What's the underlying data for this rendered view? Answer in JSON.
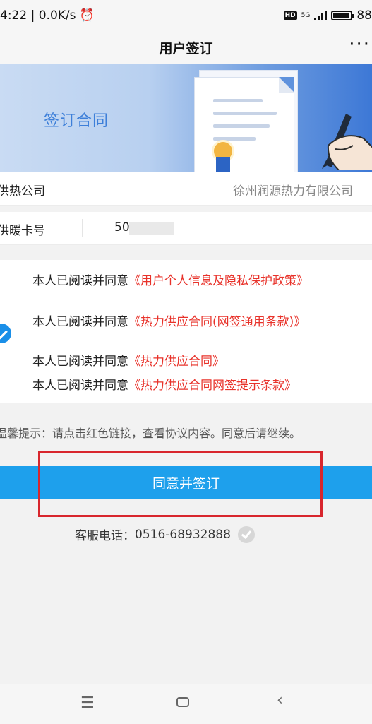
{
  "status_bar": {
    "time": "4:22",
    "separator": "|",
    "speed": "0.0K/s",
    "alarm_icon": "alarm-clock-icon",
    "hd": "HD",
    "network": "5G",
    "battery": "88"
  },
  "nav": {
    "title": "用户签订",
    "more": "···"
  },
  "banner": {
    "title": "签订合同"
  },
  "fields": {
    "company_label": "供热公司",
    "company_value": "徐州润源热力有限公司",
    "card_label": "供暖卡号",
    "card_value": "50"
  },
  "agreements": [
    {
      "prefix": "本人已阅读并同意",
      "link": "《用户个人信息及隐私保护政策》"
    },
    {
      "prefix": "本人已阅读并同意",
      "link": "《热力供应合同(网签通用条款)》"
    },
    {
      "prefix": "本人已阅读并同意",
      "link": "《热力供应合同》"
    },
    {
      "prefix": "本人已阅读并同意",
      "link": "《热力供应合同网签提示条款》"
    }
  ],
  "tip": "温馨提示：请点击红色链接，查看协议内容。同意后请继续。",
  "sign_button": "同意并签订",
  "service": {
    "label": "客服电话：",
    "phone": "0516-68932888"
  },
  "colors": {
    "primary": "#1ea0ec",
    "link": "#e8322a",
    "highlight": "#d8262d"
  }
}
